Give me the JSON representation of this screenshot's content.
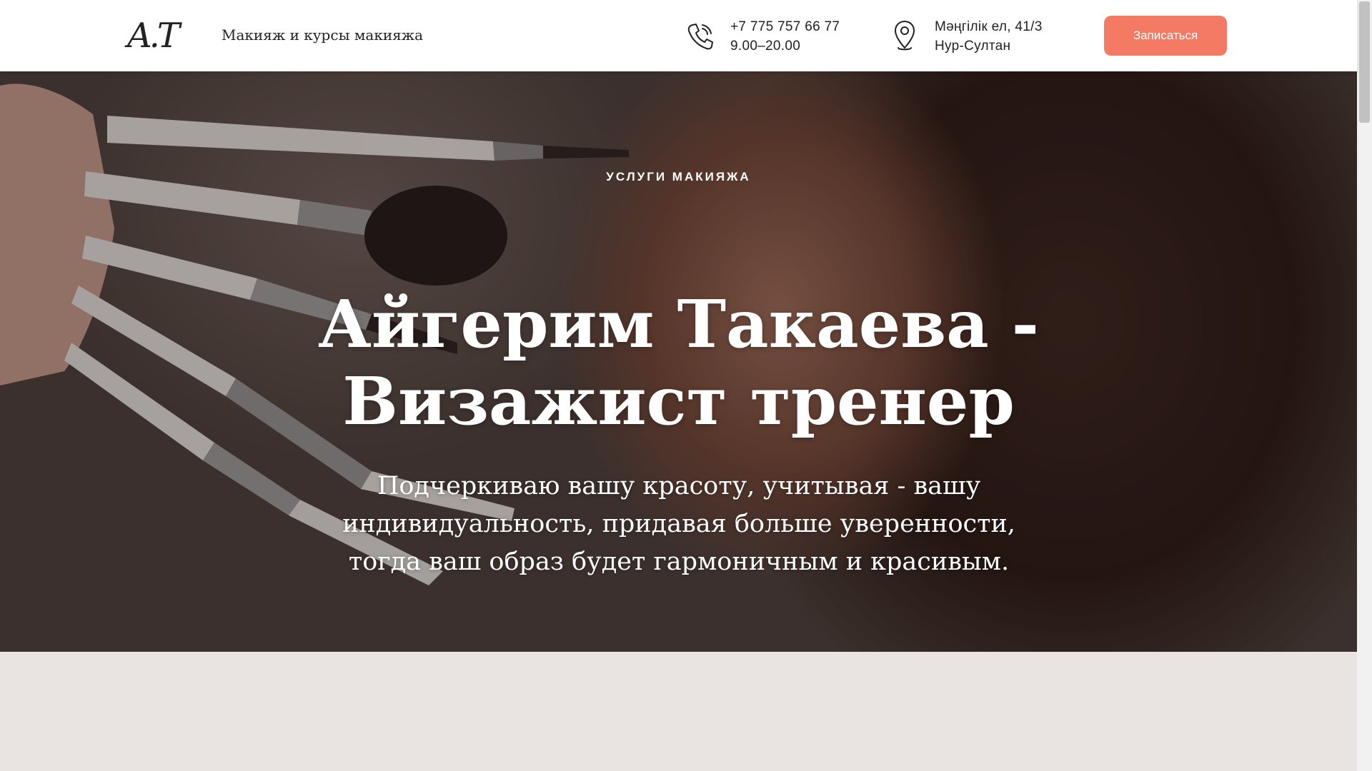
{
  "header": {
    "logo_text": "A.T",
    "tagline": "Макияж и курсы макияжа",
    "phone": "+7 775 757 66 77",
    "hours": "9.00–20.00",
    "address_line1": "Мәңгілік ел, 41/3",
    "address_line2": "Нур-Султан",
    "cta_label": "Записаться"
  },
  "hero": {
    "eyebrow": "УСЛУГИ МАКИЯЖА",
    "title_line1": "Айгерим Такаева -",
    "title_line2": "Визажист тренер",
    "subtitle_line1": "Подчеркиваю вашу красоту, учитывая - вашу",
    "subtitle_line2": "индивидуальность, придавая больше уверенности,",
    "subtitle_line3": "тогда ваш образ будет гармоничным и красивым."
  },
  "colors": {
    "accent": "#f57a63",
    "section_bg": "#e9e4e1"
  },
  "icons": {
    "phone": "phone-icon",
    "location": "location-pin-icon"
  }
}
